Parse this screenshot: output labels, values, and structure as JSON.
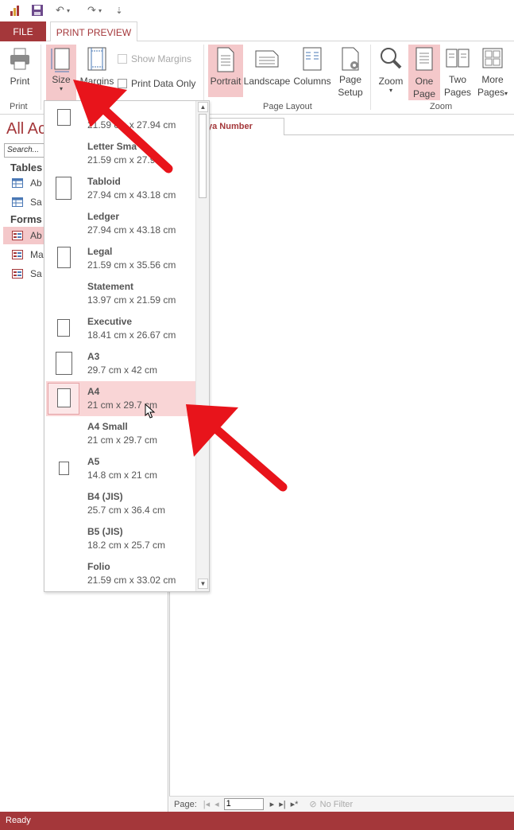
{
  "window": {
    "quick_access": {
      "undo_glyph": "↶",
      "redo_glyph": "↷",
      "more_glyph": "⇣"
    }
  },
  "tabs": {
    "file": "FILE",
    "print_preview": "PRINT PREVIEW"
  },
  "ribbon": {
    "print_group": {
      "print_label": "Print",
      "group_label": "Print"
    },
    "page_size_group": {
      "size_label": "Size",
      "margins_label": "Margins",
      "show_margins_label": "Show Margins",
      "print_data_only_label": "Print Data Only"
    },
    "page_layout_group": {
      "portrait_label": "Portrait",
      "landscape_label": "Landscape",
      "columns_label": "Columns",
      "page_setup_line1": "Page",
      "page_setup_line2": "Setup",
      "group_label": "Page Layout"
    },
    "zoom_group": {
      "zoom_label": "Zoom",
      "one_page_line1": "One",
      "one_page_line2": "Page",
      "two_pages_line1": "Two",
      "two_pages_line2": "Pages",
      "more_pages_line1": "More",
      "more_pages_line2": "Pages",
      "group_label": "Zoom"
    }
  },
  "nav_pane": {
    "title": "All Ac",
    "search_placeholder": "Search...",
    "categories": [
      {
        "label": "Tables",
        "items": [
          "Ab",
          "Sa"
        ]
      },
      {
        "label": "Forms",
        "items": [
          "Ab",
          "Ma",
          "Sa"
        ]
      }
    ]
  },
  "document": {
    "tab_label": "ya Number"
  },
  "record_nav": {
    "page_label": "Page:",
    "page_value": "1",
    "filter_label": "No Filter"
  },
  "status": {
    "text": "Ready"
  },
  "size_dropdown": {
    "items": [
      {
        "name": "",
        "dims": "21.59 cm x 27.94 cm"
      },
      {
        "name": "Letter Sma",
        "dims": "21.59 cm x 27.9"
      },
      {
        "name": "Tabloid",
        "dims": "27.94 cm x 43.18 cm"
      },
      {
        "name": "Ledger",
        "dims": "27.94 cm x 43.18 cm"
      },
      {
        "name": "Legal",
        "dims": "21.59 cm x 35.56 cm"
      },
      {
        "name": "Statement",
        "dims": "13.97 cm x 21.59 cm"
      },
      {
        "name": "Executive",
        "dims": "18.41 cm x 26.67 cm"
      },
      {
        "name": "A3",
        "dims": "29.7 cm x 42 cm"
      },
      {
        "name": "A4",
        "dims": "21 cm x 29.7 cm"
      },
      {
        "name": "A4 Small",
        "dims": "21 cm x 29.7 cm"
      },
      {
        "name": "A5",
        "dims": "14.8 cm x 21 cm"
      },
      {
        "name": "B4 (JIS)",
        "dims": "25.7 cm x 36.4 cm"
      },
      {
        "name": "B5 (JIS)",
        "dims": "18.2 cm x 25.7 cm"
      },
      {
        "name": "Folio",
        "dims": "21.59 cm x 33.02 cm"
      }
    ]
  },
  "colors": {
    "accent": "#a4373a",
    "selected_bg": "#f4c8ca",
    "hover_bg": "#f9d5d6",
    "annotation_arrow": "#e8141b"
  }
}
